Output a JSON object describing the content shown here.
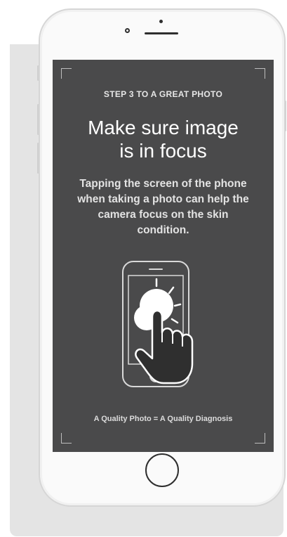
{
  "screen": {
    "step_label": "STEP 3 TO A GREAT PHOTO",
    "title_line1": "Make sure image",
    "title_line2": "is in focus",
    "description": "Tapping the screen of the phone when taking a photo can help the camera focus on the skin condition.",
    "footer": "A Quality Photo = A Quality Diagnosis",
    "illustration_icon": "tap-to-focus-phone-icon"
  },
  "colors": {
    "screen_background": "#4a4a4b",
    "text": "#ffffff",
    "device_frame": "#fafafa"
  }
}
